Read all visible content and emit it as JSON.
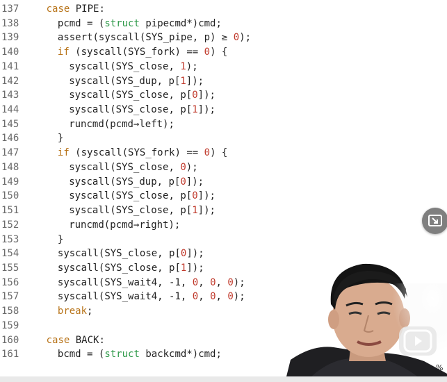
{
  "editor": {
    "lines": [
      {
        "num": "137",
        "indent": 2,
        "tokens": [
          [
            "kw",
            "case"
          ],
          [
            "pc",
            " PIPE:"
          ]
        ]
      },
      {
        "num": "138",
        "indent": 3,
        "tokens": [
          [
            "pc",
            "pcmd = ("
          ],
          [
            "ty",
            "struct"
          ],
          [
            "pc",
            " pipecmd*)cmd;"
          ]
        ]
      },
      {
        "num": "139",
        "indent": 3,
        "tokens": [
          [
            "pc",
            "assert(syscall(SYS_pipe, p) ≥ "
          ],
          [
            "nm",
            "0"
          ],
          [
            "pc",
            ");"
          ]
        ]
      },
      {
        "num": "140",
        "indent": 3,
        "tokens": [
          [
            "kw",
            "if"
          ],
          [
            "pc",
            " (syscall(SYS_fork) == "
          ],
          [
            "nm",
            "0"
          ],
          [
            "pc",
            ") {"
          ]
        ]
      },
      {
        "num": "141",
        "indent": 4,
        "tokens": [
          [
            "pc",
            "syscall(SYS_close, "
          ],
          [
            "nm",
            "1"
          ],
          [
            "pc",
            ");"
          ]
        ]
      },
      {
        "num": "142",
        "indent": 4,
        "tokens": [
          [
            "pc",
            "syscall(SYS_dup, p["
          ],
          [
            "nm",
            "1"
          ],
          [
            "pc",
            "]);"
          ]
        ]
      },
      {
        "num": "143",
        "indent": 4,
        "tokens": [
          [
            "pc",
            "syscall(SYS_close, p["
          ],
          [
            "nm",
            "0"
          ],
          [
            "pc",
            "]);"
          ]
        ]
      },
      {
        "num": "144",
        "indent": 4,
        "tokens": [
          [
            "pc",
            "syscall(SYS_close, p["
          ],
          [
            "nm",
            "1"
          ],
          [
            "pc",
            "]);"
          ]
        ]
      },
      {
        "num": "145",
        "indent": 4,
        "tokens": [
          [
            "pc",
            "runcmd(pcmd→left);"
          ]
        ]
      },
      {
        "num": "146",
        "indent": 3,
        "tokens": [
          [
            "pc",
            "}"
          ]
        ]
      },
      {
        "num": "147",
        "indent": 3,
        "tokens": [
          [
            "kw",
            "if"
          ],
          [
            "pc",
            " (syscall(SYS_fork) == "
          ],
          [
            "nm",
            "0"
          ],
          [
            "pc",
            ") {"
          ]
        ]
      },
      {
        "num": "148",
        "indent": 4,
        "tokens": [
          [
            "pc",
            "syscall(SYS_close, "
          ],
          [
            "nm",
            "0"
          ],
          [
            "pc",
            ");"
          ]
        ]
      },
      {
        "num": "149",
        "indent": 4,
        "tokens": [
          [
            "pc",
            "syscall(SYS_dup, p["
          ],
          [
            "nm",
            "0"
          ],
          [
            "pc",
            "]);"
          ]
        ]
      },
      {
        "num": "150",
        "indent": 4,
        "tokens": [
          [
            "pc",
            "syscall(SYS_close, p["
          ],
          [
            "nm",
            "0"
          ],
          [
            "pc",
            "]);"
          ]
        ]
      },
      {
        "num": "151",
        "indent": 4,
        "tokens": [
          [
            "pc",
            "syscall(SYS_close, p["
          ],
          [
            "nm",
            "1"
          ],
          [
            "pc",
            "]);"
          ]
        ]
      },
      {
        "num": "152",
        "indent": 4,
        "tokens": [
          [
            "pc",
            "runcmd(pcmd→right);"
          ]
        ]
      },
      {
        "num": "153",
        "indent": 3,
        "tokens": [
          [
            "pc",
            "}"
          ]
        ]
      },
      {
        "num": "154",
        "indent": 3,
        "tokens": [
          [
            "pc",
            "syscall(SYS_close, p["
          ],
          [
            "nm",
            "0"
          ],
          [
            "pc",
            "]);"
          ]
        ]
      },
      {
        "num": "155",
        "indent": 3,
        "tokens": [
          [
            "pc",
            "syscall(SYS_close, p["
          ],
          [
            "nm",
            "1"
          ],
          [
            "pc",
            "]);"
          ]
        ]
      },
      {
        "num": "156",
        "indent": 3,
        "tokens": [
          [
            "pc",
            "syscall(SYS_wait4, -1, "
          ],
          [
            "nm",
            "0"
          ],
          [
            "pc",
            ", "
          ],
          [
            "nm",
            "0"
          ],
          [
            "pc",
            ", "
          ],
          [
            "nm",
            "0"
          ],
          [
            "pc",
            ");"
          ]
        ]
      },
      {
        "num": "157",
        "indent": 3,
        "tokens": [
          [
            "pc",
            "syscall(SYS_wait4, -1, "
          ],
          [
            "nm",
            "0"
          ],
          [
            "pc",
            ", "
          ],
          [
            "nm",
            "0"
          ],
          [
            "pc",
            ", "
          ],
          [
            "nm",
            "0"
          ],
          [
            "pc",
            ");"
          ]
        ]
      },
      {
        "num": "158",
        "indent": 3,
        "tokens": [
          [
            "kw",
            "break"
          ],
          [
            "pc",
            ";"
          ]
        ]
      },
      {
        "num": "159",
        "indent": 0,
        "tokens": []
      },
      {
        "num": "160",
        "indent": 2,
        "tokens": [
          [
            "kw",
            "case"
          ],
          [
            "pc",
            " BACK:"
          ]
        ]
      },
      {
        "num": "161",
        "indent": 3,
        "tokens": [
          [
            "pc",
            "bcmd = ("
          ],
          [
            "ty",
            "struct"
          ],
          [
            "pc",
            " backcmd*)cmd;"
          ]
        ]
      }
    ]
  },
  "overlay": {
    "screen_button_icon": "exit-fullscreen-icon",
    "play_button_icon": "play-icon",
    "zoom_percent_suffix": "%"
  },
  "colors": {
    "keyword": "#b8741a",
    "type": "#2f9a4a",
    "number": "#c0392b",
    "text": "#222222",
    "line_number": "#6b6b6b"
  }
}
